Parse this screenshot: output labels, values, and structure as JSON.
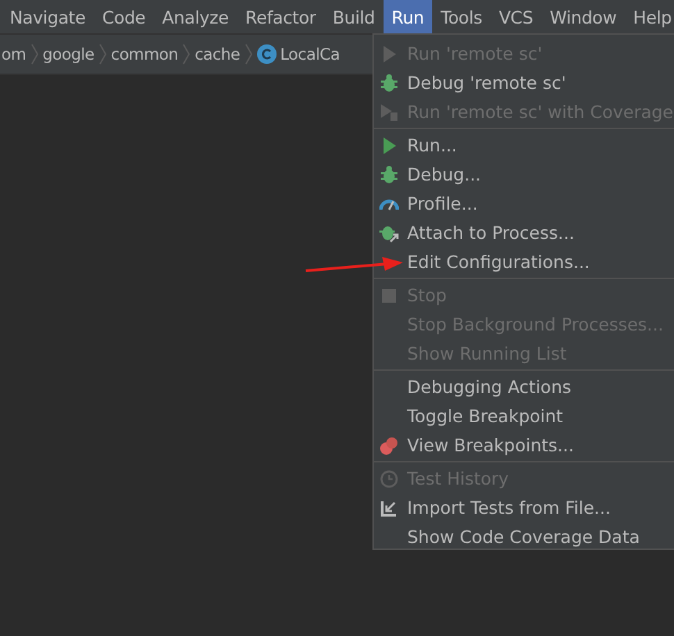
{
  "menubar": [
    {
      "label": "Navigate",
      "selected": false
    },
    {
      "label": "Code",
      "selected": false
    },
    {
      "label": "Analyze",
      "selected": false
    },
    {
      "label": "Refactor",
      "selected": false
    },
    {
      "label": "Build",
      "selected": false
    },
    {
      "label": "Run",
      "selected": true
    },
    {
      "label": "Tools",
      "selected": false
    },
    {
      "label": "VCS",
      "selected": false
    },
    {
      "label": "Window",
      "selected": false
    },
    {
      "label": "Help",
      "selected": false
    }
  ],
  "breadcrumbs": [
    {
      "label": "om",
      "kind": "package"
    },
    {
      "label": "google",
      "kind": "package"
    },
    {
      "label": "common",
      "kind": "package"
    },
    {
      "label": "cache",
      "kind": "package"
    },
    {
      "label": "LocalCa",
      "kind": "class"
    }
  ],
  "menu": {
    "groups": [
      [
        {
          "label": "Run 'remote sc'",
          "kind": "run",
          "disabled": true
        },
        {
          "label": "Debug 'remote sc'",
          "kind": "debug",
          "disabled": false
        },
        {
          "label": "Run 'remote sc' with Coverage",
          "kind": "coverage",
          "disabled": true
        }
      ],
      [
        {
          "label": "Run...",
          "kind": "run",
          "disabled": false
        },
        {
          "label": "Debug...",
          "kind": "debug",
          "disabled": false
        },
        {
          "label": "Profile...",
          "kind": "profile",
          "disabled": false
        },
        {
          "label": "Attach to Process...",
          "kind": "attach",
          "disabled": false
        },
        {
          "label": "Edit Configurations...",
          "kind": "plain",
          "disabled": false,
          "annotated": true
        }
      ],
      [
        {
          "label": "Stop",
          "kind": "stop",
          "disabled": true
        },
        {
          "label": "Stop Background Processes...",
          "kind": "plain",
          "disabled": true
        },
        {
          "label": "Show Running List",
          "kind": "plain",
          "disabled": true
        }
      ],
      [
        {
          "label": "Debugging Actions",
          "kind": "plain",
          "disabled": false
        },
        {
          "label": "Toggle Breakpoint",
          "kind": "plain",
          "disabled": false
        },
        {
          "label": "View Breakpoints...",
          "kind": "breakpoints",
          "disabled": false
        }
      ],
      [
        {
          "label": "Test History",
          "kind": "history",
          "disabled": true
        },
        {
          "label": "Import Tests from File...",
          "kind": "import",
          "disabled": false
        },
        {
          "label": "Show Code Coverage Data",
          "kind": "plain",
          "disabled": false
        }
      ]
    ]
  }
}
